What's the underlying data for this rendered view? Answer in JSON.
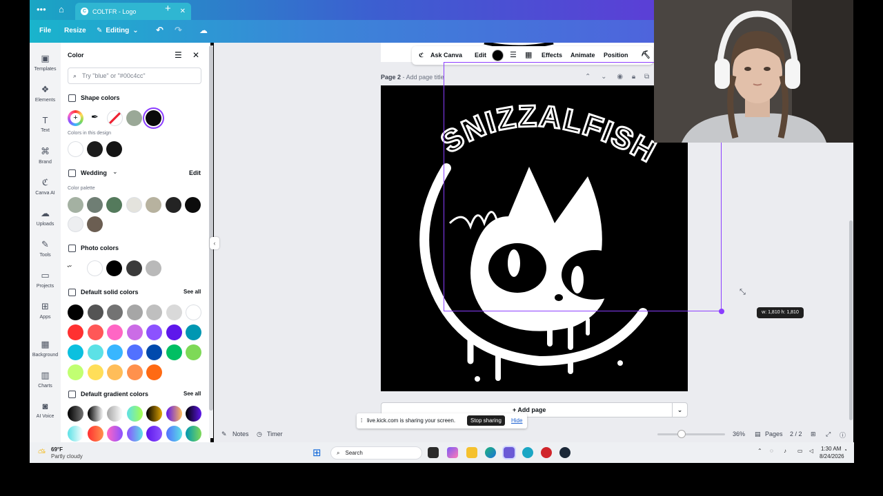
{
  "browser": {
    "tab_title": "COLTFR - Logo",
    "tab_favicon": "C"
  },
  "topbar": {
    "file": "File",
    "resize": "Resize",
    "editing": "Editing"
  },
  "rail": {
    "items": [
      {
        "label": "Templates",
        "icon": "templates-icon"
      },
      {
        "label": "Elements",
        "icon": "elements-icon"
      },
      {
        "label": "Text",
        "icon": "text-icon"
      },
      {
        "label": "Brand",
        "icon": "brand-icon"
      },
      {
        "label": "Canva AI",
        "icon": "canva-ai-icon"
      },
      {
        "label": "Uploads",
        "icon": "uploads-icon"
      },
      {
        "label": "Tools",
        "icon": "tools-icon"
      },
      {
        "label": "Projects",
        "icon": "projects-icon"
      },
      {
        "label": "Apps",
        "icon": "apps-icon"
      },
      {
        "label": "Background",
        "icon": "background-icon"
      },
      {
        "label": "Charts",
        "icon": "charts-icon"
      },
      {
        "label": "AI Voice",
        "icon": "ai-voice-icon"
      }
    ]
  },
  "panel": {
    "title": "Color",
    "search_placeholder": "Try \"blue\" or \"#00c4cc\"",
    "shape_colors": "Shape colors",
    "colors_in_design": "Colors in this design",
    "palette_name": "Wedding",
    "edit": "Edit",
    "color_palette": "Color palette",
    "photo_colors": "Photo colors",
    "default_solid": "Default solid colors",
    "see_all": "See all",
    "default_gradient": "Default gradient colors",
    "shape_swatches": [
      "#9aa897",
      "#0a0a0a"
    ],
    "design_swatches": [
      "#ffffff",
      "#1c1c1c",
      "#141414"
    ],
    "palette_swatches": [
      "#a4b1a2",
      "#6f7e74",
      "#547a5c",
      "#e4e3dd",
      "#b7b29f",
      "#232323",
      "#0c0c0c",
      "#edeef0",
      "#6b5e52"
    ],
    "photo_swatches": [
      "#ffffff",
      "#000000",
      "#3a3a3a",
      "#b9b9b9"
    ],
    "solid_swatches": [
      "#000000",
      "#545454",
      "#737373",
      "#a6a6a6",
      "#bfbfbf",
      "#d9d9d9",
      "#ffffff",
      "#ff3131",
      "#ff5757",
      "#ff66c4",
      "#cb6ce6",
      "#8c52ff",
      "#5e17eb",
      "#0097b2",
      "#0cc0df",
      "#5ce1e6",
      "#38b6ff",
      "#5271ff",
      "#004aad",
      "#00bf63",
      "#7ed957",
      "#c1ff72",
      "#ffde59",
      "#ffbd59",
      "#ff914d",
      "#ff6a13"
    ],
    "gradient_swatches": [
      "linear-gradient(90deg,#000,#737373)",
      "linear-gradient(90deg,#000,#fff)",
      "linear-gradient(90deg,#a6a6a6,#fff)",
      "linear-gradient(90deg,#5de0e6,#a6ff4d)",
      "linear-gradient(90deg,#000,#e0a300)",
      "linear-gradient(90deg,#5e17eb,#ffbd59)",
      "linear-gradient(90deg,#000,#5e17eb)"
    ]
  },
  "toolbar": {
    "ask_canva": "Ask Canva",
    "edit": "Edit",
    "effects": "Effects",
    "animate": "Animate",
    "position": "Position"
  },
  "page": {
    "label": "Page 2",
    "add_title": "Add page title",
    "logo_text": "SNIZZALFISH",
    "dimensions": "w: 1,810 h: 1,810",
    "add_page": "+ Add page"
  },
  "share": {
    "message": "live.kick.com is sharing your screen.",
    "stop": "Stop sharing",
    "hide": "Hide"
  },
  "bottom": {
    "notes": "Notes",
    "timer": "Timer",
    "zoom": "36%",
    "zoom_level": 0.36,
    "pages": "Pages",
    "page_count": "2 / 2"
  },
  "taskbar": {
    "temp": "69°F",
    "weather": "Partly cloudy",
    "search": "Search",
    "time": "1:30 AM",
    "date": "8/24/2026"
  }
}
